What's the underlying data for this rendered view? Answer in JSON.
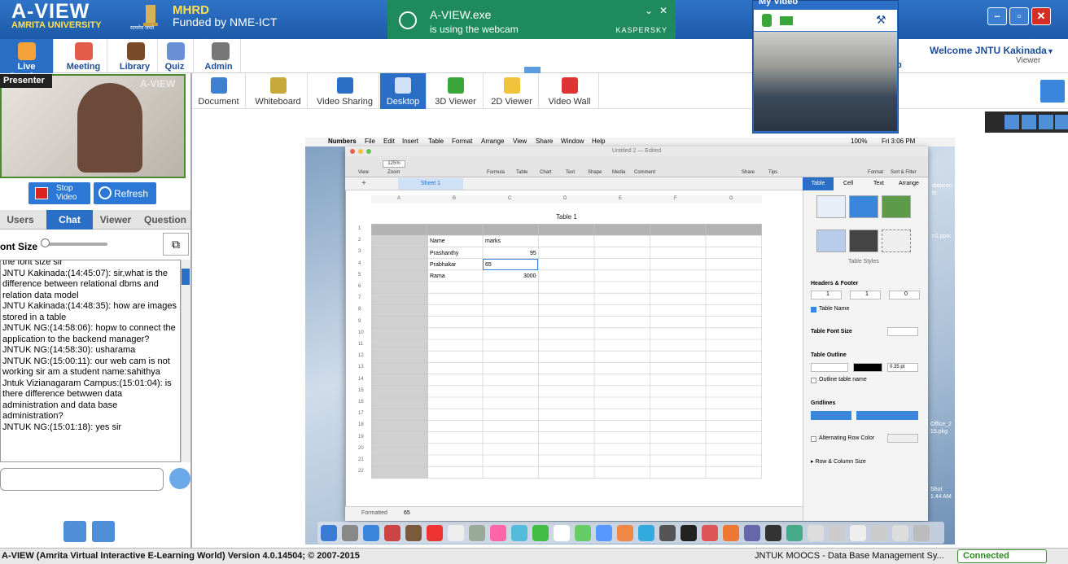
{
  "app": {
    "logo_title": "A-VIEW",
    "logo_subtitle": "AMRITA UNIVERSITY",
    "mhrd_title": "MHRD",
    "mhrd_subtitle": "Funded by NME-ICT",
    "emblem_caption": "सत्यमेव जयते"
  },
  "notification": {
    "title": "A-VIEW.exe",
    "message": "is using the webcam",
    "brand": "KASPERSKY"
  },
  "nav": {
    "items": [
      {
        "label": "Live Session",
        "icon": "live-session-icon"
      },
      {
        "label": "Meeting",
        "icon": "meeting-icon"
      },
      {
        "label": "Library",
        "icon": "library-icon"
      },
      {
        "label": "Quiz",
        "icon": "quiz-icon"
      },
      {
        "label": "Admin",
        "icon": "admin-icon"
      }
    ],
    "help_fragment": "lp",
    "welcome": "Welcome JNTU Kakinada",
    "role": "Viewer"
  },
  "presenter": {
    "label": "Presenter",
    "watermark": "A-VIEW",
    "stop_video_line1": "Stop",
    "stop_video_line2": "Video",
    "refresh": "Refresh"
  },
  "panel_tabs": [
    "Users",
    "Chat",
    "Viewer",
    "Question"
  ],
  "chat": {
    "font_size_label": "ont Size",
    "messages": [
      "the font size sir",
      "JNTU Kakinada:(14:45:07):  sir,what is the difference between relational dbms and relation data model",
      "JNTU Kakinada:(14:48:35):  how are images stored in a table",
      "JNTUK NG:(14:58:06):  hopw to connect the application to the backend manager?",
      "JNTUK NG:(14:58:30):  usharama",
      "JNTUK NG:(15:00:11):  our web cam is not working sir am a student name:sahithya",
      "Jntuk Vizianagaram Campus:(15:01:04):  is there difference betwwen data administration and data base administration?",
      "JNTUK NG:(15:01:18):  yes sir"
    ]
  },
  "tools": [
    {
      "label": "Document"
    },
    {
      "label": "Whiteboard"
    },
    {
      "label": "Video Sharing"
    },
    {
      "label": "Desktop"
    },
    {
      "label": "3D Viewer"
    },
    {
      "label": "2D Viewer"
    },
    {
      "label": "Video Wall"
    }
  ],
  "my_video": {
    "title": "My Video"
  },
  "mac": {
    "menu": [
      "Numbers",
      "File",
      "Edit",
      "Insert",
      "Table",
      "Format",
      "Arrange",
      "View",
      "Share",
      "Window",
      "Help"
    ],
    "clock": "Fri 3:06 PM",
    "battery": "100%",
    "window_title": "Untitled 2 — Edited",
    "toolbar": [
      "View",
      "Zoom",
      "Formula",
      "Table",
      "Chart",
      "Text",
      "Shape",
      "Media",
      "Comment",
      "Share",
      "Tips",
      "Format",
      "Sort & Filter"
    ],
    "zoom_value": "125%",
    "sheet_tab": "Sheet 1",
    "table_title": "Table 1",
    "columns": [
      "A",
      "B",
      "C",
      "D",
      "E",
      "F",
      "G"
    ],
    "rows": [
      {
        "b": "Name",
        "c": "marks"
      },
      {
        "b": "Prashanthy",
        "c": "95"
      },
      {
        "b": "Prabhakar",
        "c": "65"
      },
      {
        "b": "Rama",
        "c": "3000"
      }
    ],
    "row_count": 22,
    "formula_bar_label": "Formatted",
    "formula_bar_value": "65",
    "side_tabs": [
      "Table",
      "Cell",
      "Text",
      "Arrange"
    ],
    "side": {
      "table_styles": "Table Styles",
      "headers_footer": "Headers & Footer",
      "header_rows": "1",
      "header_cols": "1",
      "footer_rows": "0",
      "table_name": "Table Name",
      "table_font_size": "Table Font Size",
      "table_outline": "Table Outline",
      "outline_width": "0.35 pt",
      "outline_table_name": "Outline table name",
      "gridlines": "Gridlines",
      "alternating": "Alternating Row Color",
      "row_col_size": "Row & Column Size"
    },
    "desktop_files": [
      "datacen",
      "ts",
      "n1.pptx",
      "Office_2",
      "15.pkg",
      "Shot",
      "1.44 AM"
    ]
  },
  "status": {
    "left": "A-VIEW (Amrita Virtual Interactive E-Learning World) Version 4.0.14504; © 2007-2015",
    "right": "JNTUK MOOCS - Data Base Management Sy...",
    "connected": "Connected"
  }
}
